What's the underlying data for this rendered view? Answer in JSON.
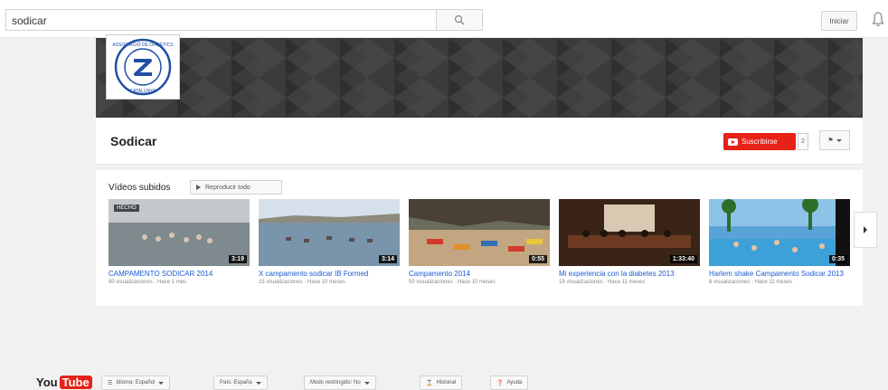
{
  "search": {
    "value": "sodicar"
  },
  "header": {
    "signin_label": "Iniciar"
  },
  "logo": {
    "text_top": "ASSOCIACIÓ DE DIABÈTICS",
    "text_bottom": "CATALUNYA"
  },
  "channel": {
    "name": "Sodicar",
    "subscribe_label": "Suscribirse",
    "subscriber_count": "2",
    "flag_label": "⚑"
  },
  "videos_section": {
    "title": "Vídeos subidos",
    "play_all_label": "Reproducir todo",
    "videos": [
      {
        "title": "CAMPAMENTO SODICAR 2014",
        "meta": "90 visualizaciones · Hace 1 mes",
        "duration": "3:19",
        "badge": "HECHO"
      },
      {
        "title": "X campamento sodicar IB Formed",
        "meta": "15 visualizaciones · Hace 10 meses",
        "duration": "3:14",
        "badge": ""
      },
      {
        "title": "Campamento 2014",
        "meta": "50 visualizaciones · Hace 10 meses",
        "duration": "0:55",
        "badge": ""
      },
      {
        "title": "Mi experiencia con la diabetes 2013",
        "meta": "18 visualizaciones · Hace 11 meses",
        "duration": "1:33:40",
        "badge": ""
      },
      {
        "title": "Harlem shake Campamento Sodicar 2013",
        "meta": "8 visualizaciones · Hace 11 meses",
        "duration": "0:35",
        "badge": ""
      }
    ]
  },
  "footer": {
    "logo_you": "You",
    "logo_tube": "Tube",
    "language_label": "Idioma: Español",
    "country_label": "País: España",
    "restricted_label": "Modo restringido: No",
    "history_label": "Historial",
    "help_label": "Ayuda"
  }
}
